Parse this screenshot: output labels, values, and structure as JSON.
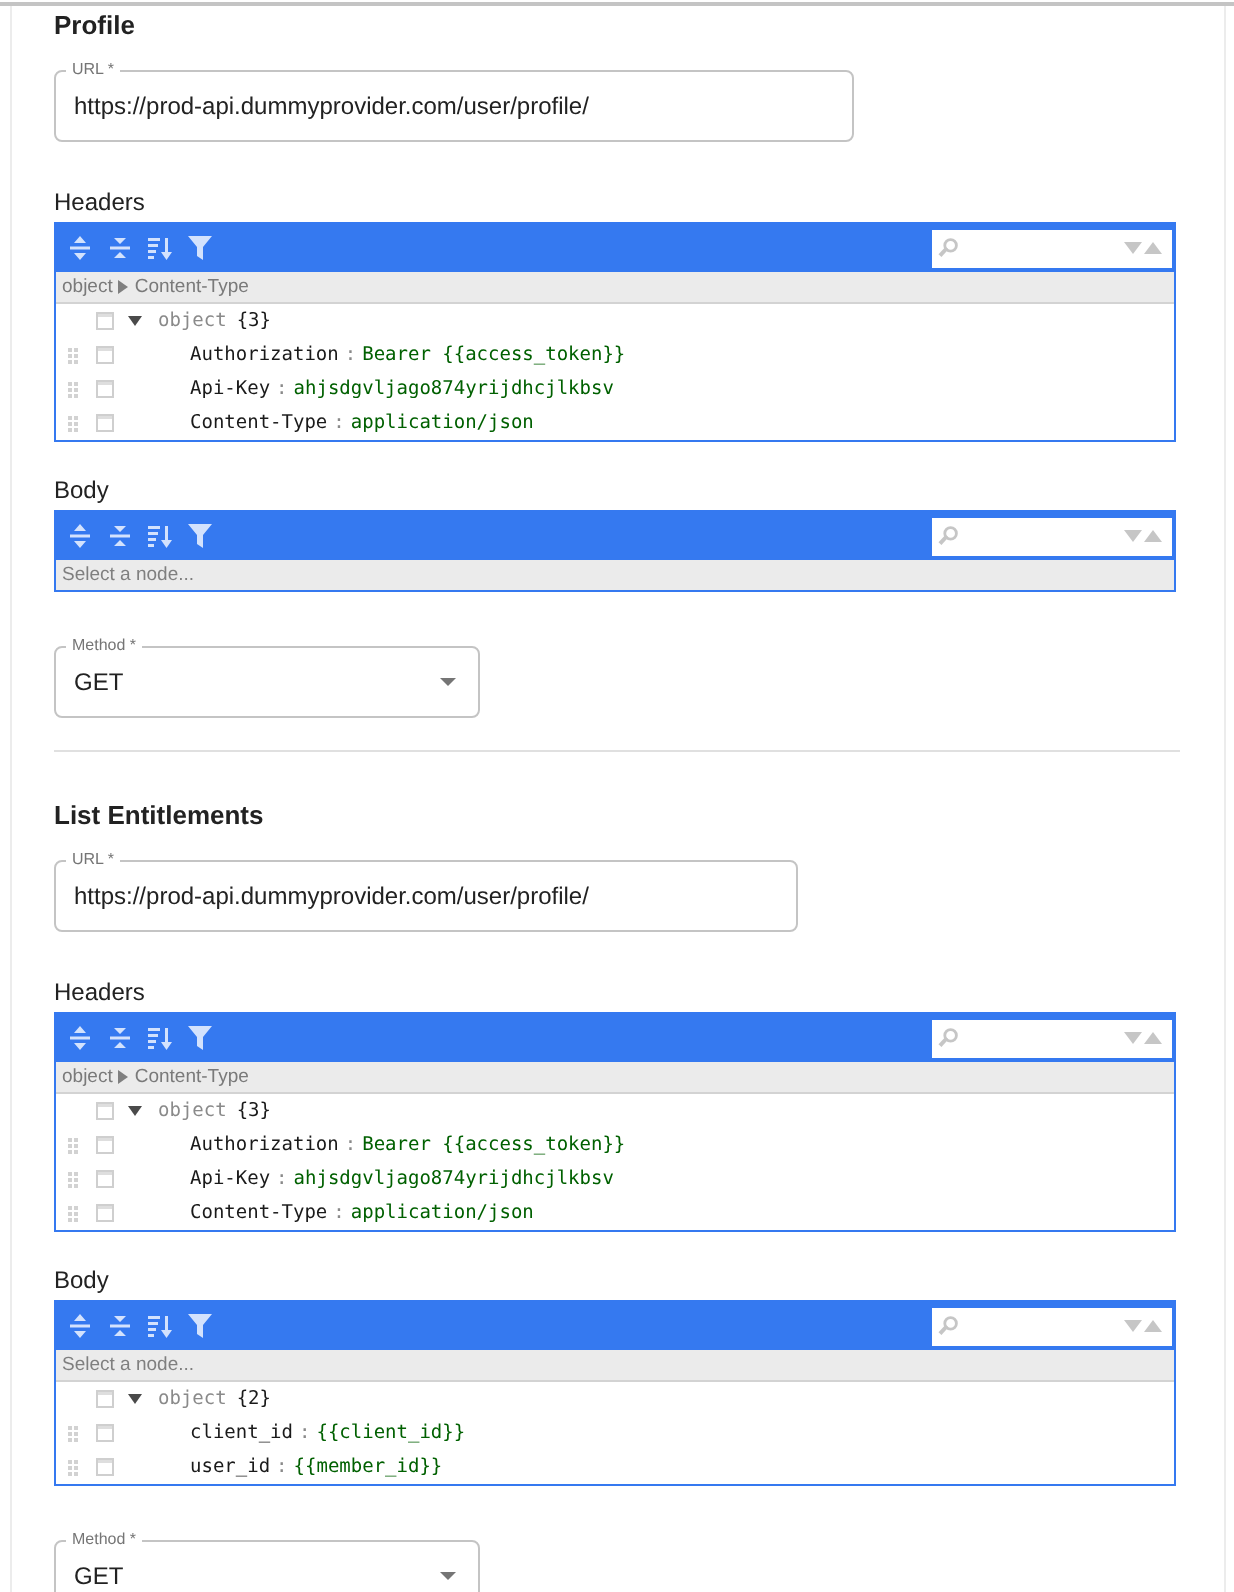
{
  "sections": [
    {
      "title": "Profile",
      "url": {
        "label": "URL *",
        "value": "https://prod-api.dummyprovider.com/user/profile/"
      },
      "headers": {
        "label": "Headers",
        "breadcrumb": [
          "object",
          "Content-Type"
        ],
        "tree": {
          "type": "object",
          "count": "{3}",
          "expanded": true,
          "children": [
            {
              "key": "Authorization",
              "separator": ":",
              "value": "Bearer {{access_token}}"
            },
            {
              "key": "Api-Key",
              "separator": ":",
              "value": "ahjsdgvljago874yrijdhcjlkbsv"
            },
            {
              "key": "Content-Type",
              "separator": ":",
              "value": "application/json"
            }
          ]
        }
      },
      "body": {
        "label": "Body",
        "navigation_hint": "Select a node..."
      },
      "method": {
        "label": "Method *",
        "value": "GET"
      }
    },
    {
      "title": "List Entitlements",
      "url": {
        "label": "URL *",
        "value": "https://prod-api.dummyprovider.com/user/profile/"
      },
      "headers": {
        "label": "Headers",
        "breadcrumb": [
          "object",
          "Content-Type"
        ],
        "tree": {
          "type": "object",
          "count": "{3}",
          "expanded": true,
          "children": [
            {
              "key": "Authorization",
              "separator": ":",
              "value": "Bearer {{access_token}}"
            },
            {
              "key": "Api-Key",
              "separator": ":",
              "value": "ahjsdgvljago874yrijdhcjlkbsv"
            },
            {
              "key": "Content-Type",
              "separator": ":",
              "value": "application/json"
            }
          ]
        }
      },
      "body": {
        "label": "Body",
        "navigation_hint": "Select a node...",
        "tree": {
          "type": "object",
          "count": "{2}",
          "expanded": true,
          "children": [
            {
              "key": "client_id",
              "separator": ":",
              "value": "{{client_id}}"
            },
            {
              "key": "user_id",
              "separator": ":",
              "value": "{{member_id}}"
            }
          ]
        }
      },
      "method": {
        "label": "Method *",
        "value": "GET"
      }
    }
  ]
}
